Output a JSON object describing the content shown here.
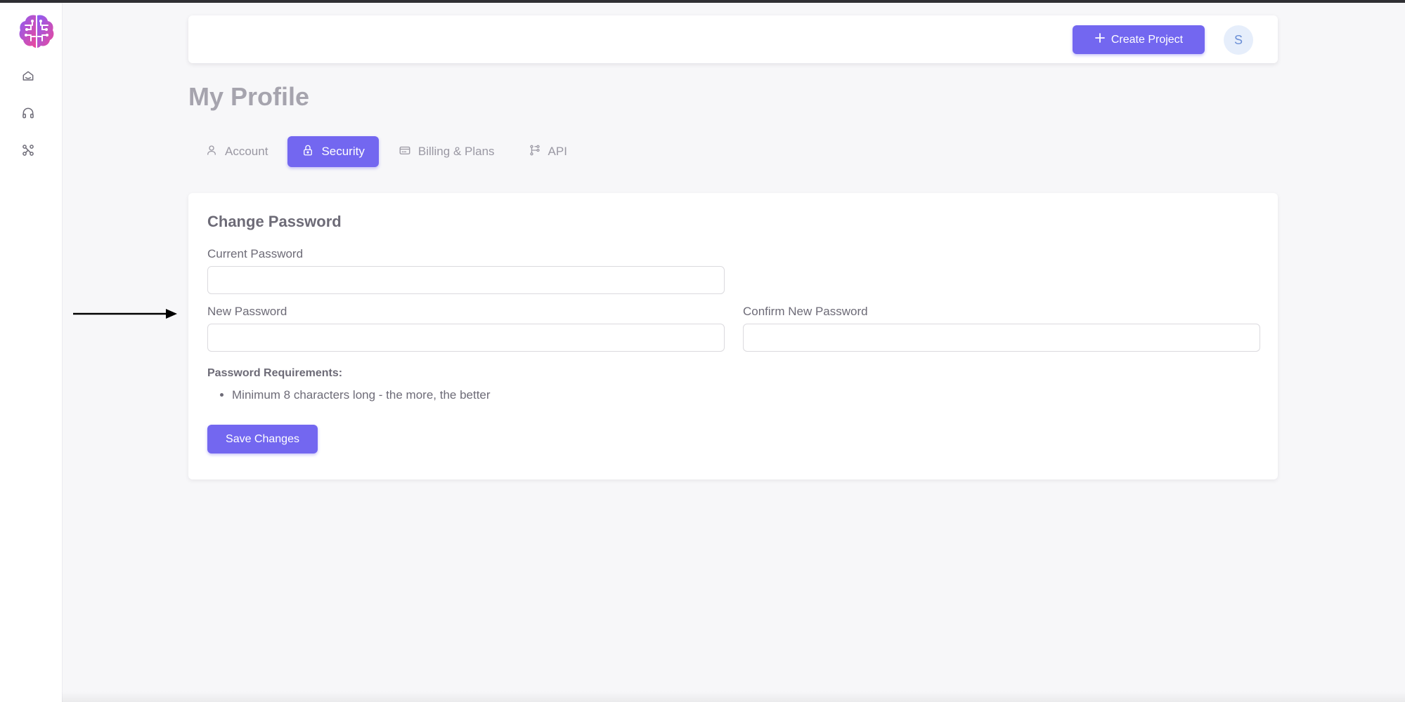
{
  "brand": {
    "logo_icon": "brain-logo",
    "accent_color": "#7367f0"
  },
  "sidebar": {
    "items": [
      {
        "icon": "home-icon"
      },
      {
        "icon": "headphones-icon"
      },
      {
        "icon": "network-icon"
      }
    ]
  },
  "topbar": {
    "create_label": "Create Project",
    "create_icon": "plus-icon",
    "avatar_initial": "S"
  },
  "page": {
    "title": "My Profile"
  },
  "tabs": [
    {
      "label": "Account",
      "icon": "user-icon",
      "active": false
    },
    {
      "label": "Security",
      "icon": "lock-icon",
      "active": true
    },
    {
      "label": "Billing & Plans",
      "icon": "credit-card-icon",
      "active": false
    },
    {
      "label": "API",
      "icon": "api-icon",
      "active": false
    }
  ],
  "change_password": {
    "title": "Change Password",
    "current_label": "Current Password",
    "current_value": "",
    "new_label": "New Password",
    "new_value": "",
    "confirm_label": "Confirm New Password",
    "confirm_value": "",
    "requirements_title": "Password Requirements:",
    "requirements": [
      "Minimum 8 characters long - the more, the better"
    ],
    "save_label": "Save Changes"
  },
  "annotation": {
    "arrow_icon": "arrow-right-icon"
  }
}
